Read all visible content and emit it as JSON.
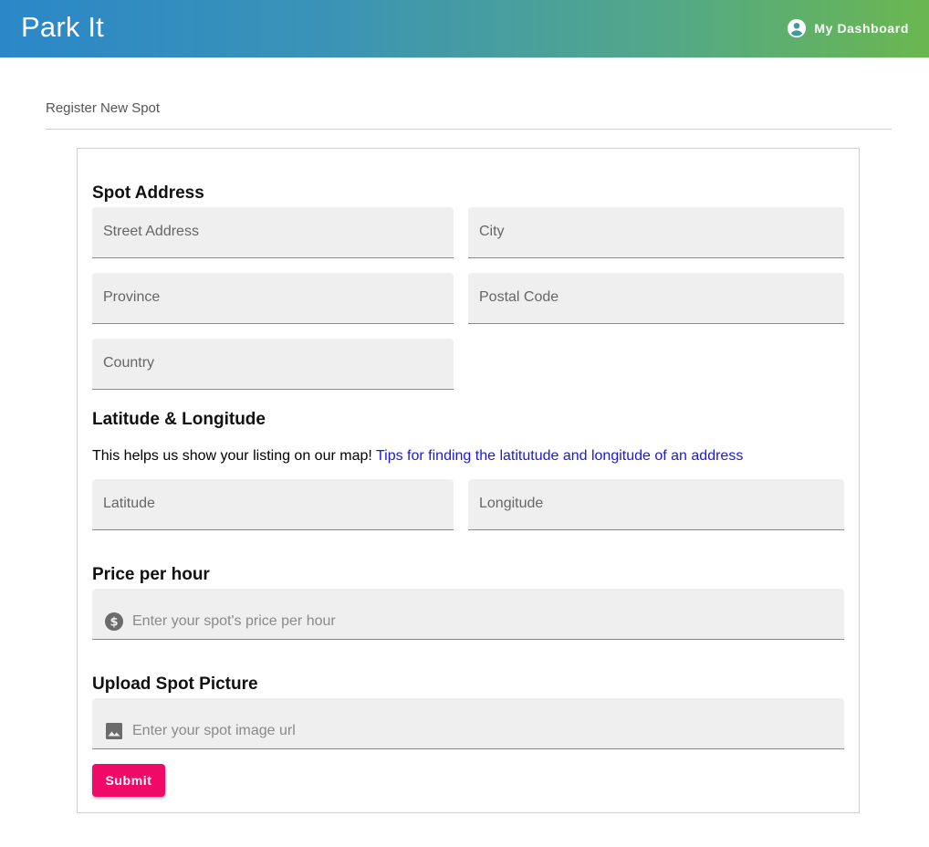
{
  "app": {
    "brand": "Park It",
    "dashboard_label": "My Dashboard"
  },
  "page": {
    "title": "Register New Spot"
  },
  "form": {
    "address_section": {
      "title": "Spot Address",
      "street_placeholder": "Street Address",
      "city_placeholder": "City",
      "province_placeholder": "Province",
      "postal_placeholder": "Postal Code",
      "country_placeholder": "Country"
    },
    "latlng_section": {
      "title": "Latitude & Longitude",
      "help_text": "This helps us show your listing on our map! ",
      "help_link": "Tips for finding the latitutude and longitude of an address",
      "latitude_placeholder": "Latitude",
      "longitude_placeholder": "Longitude"
    },
    "price_section": {
      "title": "Price per hour",
      "placeholder": "Enter your spot's price per hour",
      "icon": "dollar-icon"
    },
    "picture_section": {
      "title": "Upload Spot Picture",
      "placeholder": "Enter your spot image url",
      "icon": "image-icon"
    },
    "submit_label": "Submit"
  },
  "colors": {
    "appbar_gradient_start": "#2b87c8",
    "appbar_gradient_end": "#6ab750",
    "submit": "#ee0a66",
    "link": "#1a1ad6",
    "field_bg": "#efefef"
  }
}
